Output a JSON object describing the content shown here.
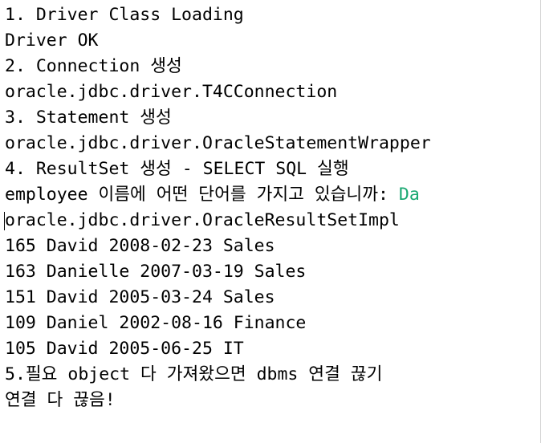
{
  "console": {
    "lines": [
      "1. Driver Class Loading",
      "Driver OK",
      "2. Connection 생성",
      "oracle.jdbc.driver.T4CConnection",
      "3. Statement 생성",
      "oracle.jdbc.driver.OracleStatementWrapper",
      "4. ResultSet 생성 - SELECT SQL 실행"
    ],
    "prompt": {
      "text": "employee 이름에 어떤 단어를 가지고 있습니까: ",
      "input": "Da"
    },
    "after_prompt": [
      "oracle.jdbc.driver.OracleResultSetImpl",
      "165 David 2008-02-23 Sales",
      "163 Danielle 2007-03-19 Sales",
      "151 David 2005-03-24 Sales",
      "109 Daniel 2002-08-16 Finance",
      "105 David 2005-06-25 IT",
      "5.필요 object 다 가져왔으면 dbms 연결 끊기",
      "연결 다 끊음!"
    ],
    "colors": {
      "text": "#000000",
      "user_input": "#1aa872",
      "background": "#ffffff"
    }
  }
}
